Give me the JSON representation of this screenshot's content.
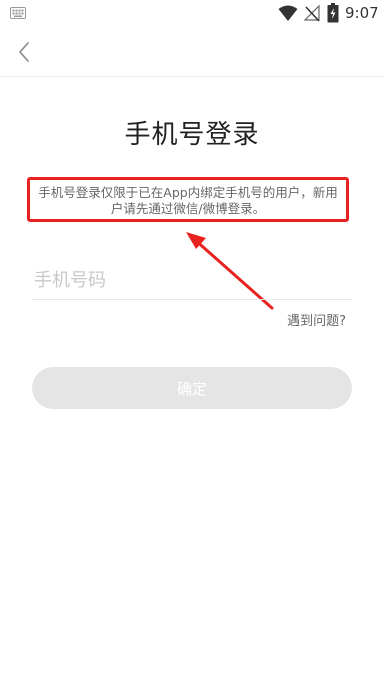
{
  "status_bar": {
    "time": "9:07",
    "icons": [
      "keyboard-icon",
      "wifi-icon",
      "no-signal-icon",
      "battery-charging-icon"
    ]
  },
  "nav": {
    "back_icon": "chevron-left-icon"
  },
  "page": {
    "title": "手机号登录",
    "notice": "手机号登录仅限于已在App内绑定手机号的用户，新用户请先通过微信/微博登录。",
    "notice_highlight_color": "#e8231f",
    "phone_placeholder": "手机号码",
    "phone_value": "",
    "help_label": "遇到问题?",
    "confirm_label": "确定"
  },
  "colors": {
    "annotation": "#e8231f",
    "button_bg": "#e5e5e5",
    "button_text": "#ffffff"
  }
}
